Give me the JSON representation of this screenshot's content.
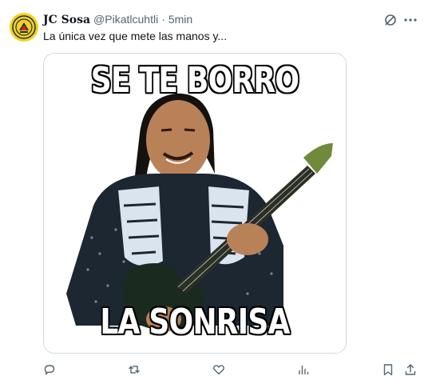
{
  "tweet": {
    "display_name": "JC Sosa",
    "handle": "@Pikatlcuhtli",
    "separator": "·",
    "time": "5min",
    "text": "La única vez que mete las manos y...",
    "media": {
      "caption_top": "SE TE BORRO",
      "caption_bottom": "LA SONRISA"
    },
    "avatar_icon": "club-america-crest-icon",
    "header_icons": [
      "grok-icon",
      "more-icon"
    ],
    "actions": [
      {
        "name": "reply",
        "icon": "reply-icon",
        "count": ""
      },
      {
        "name": "retweet",
        "icon": "retweet-icon",
        "count": ""
      },
      {
        "name": "like",
        "icon": "heart-icon",
        "count": ""
      },
      {
        "name": "views",
        "icon": "views-icon",
        "count": ""
      },
      {
        "name": "bookmark",
        "icon": "bookmark-icon",
        "count": ""
      },
      {
        "name": "share",
        "icon": "share-icon",
        "count": ""
      }
    ],
    "colors": {
      "text": "#0f1419",
      "secondary": "#536471",
      "border": "#cfd9de",
      "avatar_bg": "#f5d21a"
    }
  }
}
